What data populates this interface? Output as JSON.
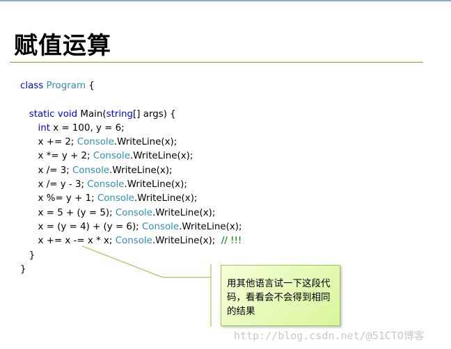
{
  "slide": {
    "title": "赋值运算"
  },
  "code": {
    "lines": [
      [
        {
          "t": "class ",
          "c": "kw"
        },
        {
          "t": "Program",
          "c": "ty"
        },
        {
          "t": " {",
          "c": ""
        }
      ],
      [],
      [
        {
          "t": "   static void ",
          "c": "kw"
        },
        {
          "t": "Main(",
          "c": ""
        },
        {
          "t": "string",
          "c": "kw"
        },
        {
          "t": "[] args) {",
          "c": ""
        }
      ],
      [
        {
          "t": "      int",
          "c": "kw"
        },
        {
          "t": " x = 100, y = 6;",
          "c": ""
        }
      ],
      [
        {
          "t": "      x += 2; ",
          "c": ""
        },
        {
          "t": "Console",
          "c": "ty"
        },
        {
          "t": ".WriteLine(x);",
          "c": ""
        }
      ],
      [
        {
          "t": "      x *= y + 2; ",
          "c": ""
        },
        {
          "t": "Console",
          "c": "ty"
        },
        {
          "t": ".WriteLine(x);",
          "c": ""
        }
      ],
      [
        {
          "t": "      x /= 3; ",
          "c": ""
        },
        {
          "t": "Console",
          "c": "ty"
        },
        {
          "t": ".WriteLine(x);",
          "c": ""
        }
      ],
      [
        {
          "t": "      x /= y - 3; ",
          "c": ""
        },
        {
          "t": "Console",
          "c": "ty"
        },
        {
          "t": ".WriteLine(x);",
          "c": ""
        }
      ],
      [
        {
          "t": "      x %= y + 1; ",
          "c": ""
        },
        {
          "t": "Console",
          "c": "ty"
        },
        {
          "t": ".WriteLine(x);",
          "c": ""
        }
      ],
      [
        {
          "t": "      x = 5 + (y = 5); ",
          "c": ""
        },
        {
          "t": "Console",
          "c": "ty"
        },
        {
          "t": ".WriteLine(x);",
          "c": ""
        }
      ],
      [
        {
          "t": "      x = (y = 4) + (y = 6); ",
          "c": ""
        },
        {
          "t": "Console",
          "c": "ty"
        },
        {
          "t": ".WriteLine(x);",
          "c": ""
        }
      ],
      [
        {
          "t": "      x += x -= x * x; ",
          "c": ""
        },
        {
          "t": "Console",
          "c": "ty"
        },
        {
          "t": ".WriteLine(x);  ",
          "c": ""
        },
        {
          "t": "// !!!",
          "c": "cm"
        }
      ],
      [
        {
          "t": "   }",
          "c": ""
        }
      ],
      [
        {
          "t": "}",
          "c": ""
        }
      ]
    ]
  },
  "callout": {
    "text": "用其他语言试一下这段代码，看看会不会得到相同的结果"
  },
  "watermark": {
    "text": "http://blog.csdn.net/@51CTO博客"
  },
  "colors": {
    "keyword": "#0000ff",
    "type": "#2b91af",
    "comment": "#008000",
    "rule": "#9a9a1c",
    "callout_border": "#9cc85a"
  }
}
